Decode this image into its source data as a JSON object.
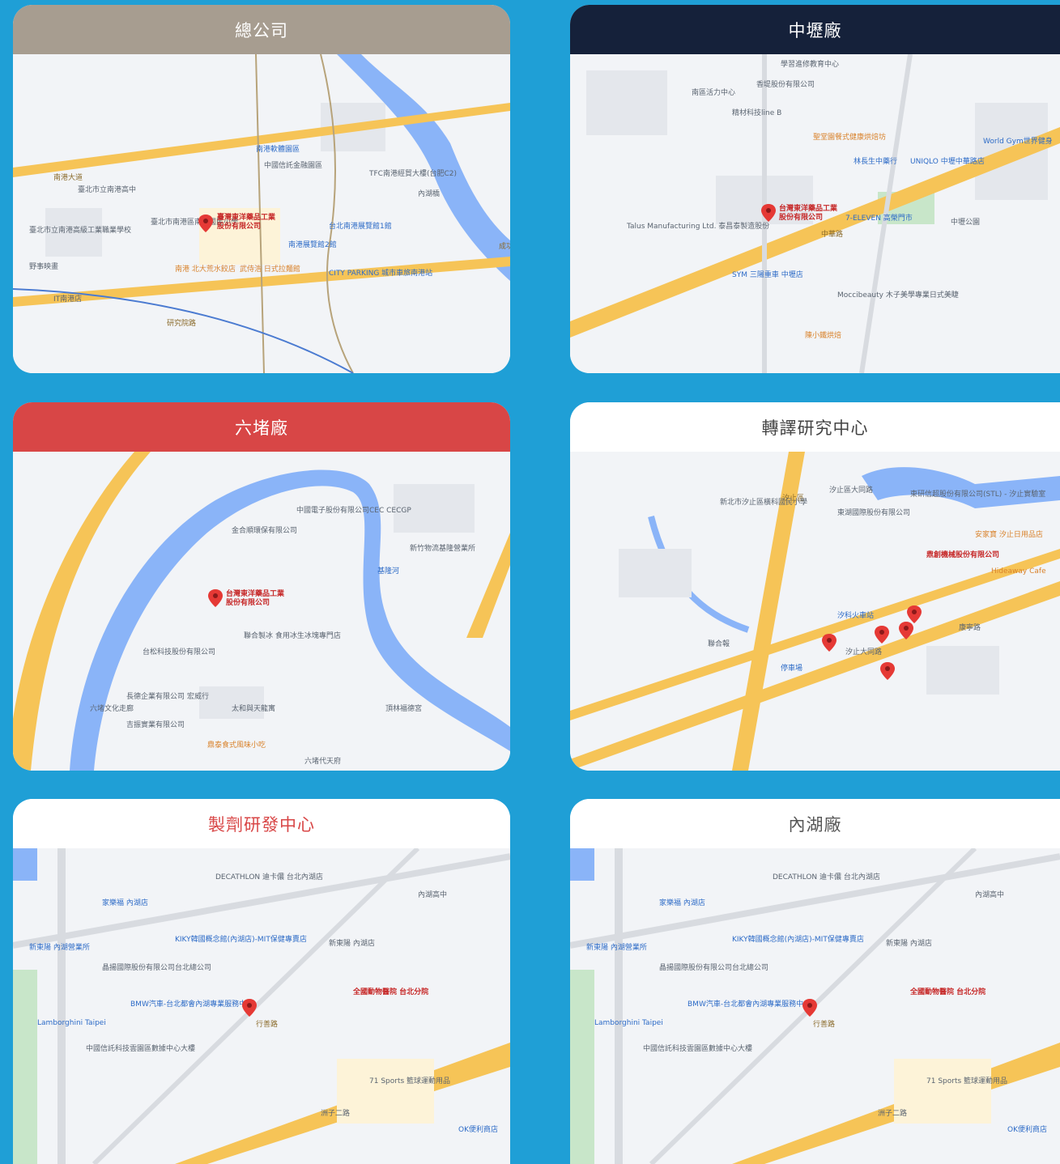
{
  "colors": {
    "page_background": "#1f9fd6",
    "header_hq": "#a79d90",
    "header_zhongli": "#15213a",
    "header_liudu": "#d84646",
    "header_white": "#ffffff",
    "title_red": "#d84646",
    "title_gray": "#555555",
    "map_land": "#f2f4f7",
    "map_river": "#8ab4f8",
    "map_highway": "#f6c457",
    "map_block": "#e4e7ec",
    "map_park": "#c8e6c9",
    "pin_red": "#e53935"
  },
  "locations": [
    {
      "title": "總公司",
      "map": {
        "pin_label_1": "臺灣東洋藥品工業",
        "pin_label_2": "股份有限公司",
        "labels": [
          "臺北市立南港高中",
          "臺北市立南港高級工業職業學校",
          "臺北市南港區南港國民小學",
          "南港軟體園區",
          "中國信託金融園區",
          "TFC南港經貿大樓(台肥C2)",
          "台北南港展覽館1館",
          "南港展覽館2館",
          "CITY PARKING 城市車旅南港站",
          "南港 北大荒水餃店",
          "武侍浩 日式拉麵館",
          "野事映畫",
          "IT南港店",
          "內湖橋",
          "南港大道",
          "研究院路",
          "成功橋"
        ]
      }
    },
    {
      "title": "中壢廠",
      "map": {
        "pin_label_1": "台灣東洋藥品工業",
        "pin_label_2": "股份有限公司",
        "labels": [
          "學習進修教育中心",
          "南區活力中心",
          "香堤股份有限公司",
          "精材科技line B",
          "聖堂園餐式健康烘焙坊",
          "UNIQLO 中壢中華路店",
          "World Gym世界健身",
          "林長生中藥行",
          "7-ELEVEN 高榮門市",
          "Talus Manufacturing Ltd. 泰昌泰製造股份",
          "SYM 三陽重車 中壢店",
          "中壢公園",
          "Moccibeauty 木子美學專業日式美睫",
          "陳小鐵烘焙",
          "中華路"
        ]
      }
    },
    {
      "title": "六堵廠",
      "map": {
        "pin_label_1": "台灣東洋藥品工業",
        "pin_label_2": "股份有限公司",
        "labels": [
          "中國電子股份有限公司CEC CECGP",
          "金合順環保有限公司",
          "新竹物流基隆營業所",
          "聯合製冰 食用冰生冰塊專門店",
          "台松科技股份有限公司",
          "長德企業有限公司",
          "宏威行",
          "太和與天龍寓",
          "吉振實業有限公司",
          "六堵文化走廊",
          "基隆河",
          "鼎泰食式風味小吃",
          "頂林福德宮",
          "六堵代天府"
        ]
      }
    },
    {
      "title": "轉譯研究中心",
      "map": {
        "pin_label_1": "",
        "pin_label_2": "",
        "labels": [
          "汐止區",
          "新北市汐止區橫科國民小學",
          "汐止區大同路",
          "東研信超股份有限公司(STL) - 汐止實驗室",
          "東湖國際股份有限公司",
          "鼎創機械股份有限公司",
          "安家寶 汐止日用品店",
          "汐科火車站",
          "汐止大同路",
          "Hideaway Cafe",
          "康寧路",
          "聯合報",
          "停車場"
        ]
      }
    },
    {
      "title": "製劑研發中心",
      "map": {
        "pin_label_1": "",
        "pin_label_2": "",
        "labels": [
          "DECATHLON 迪卡儂 台北內湖店",
          "家樂福 內湖店",
          "KIKY韓國概念館(內湖店)-MIT保健專賣店",
          "新東陽 內湖營業所",
          "晶揚國際股份有限公司台北總公司",
          "BMW汽車-台北都會內湖專業服務中心",
          "Lamborghini Taipei",
          "中國信託科技雲園區數據中心大樓",
          "新東陽 內湖店",
          "全國動物醫院 台北分院",
          "71 Sports 籃球運動用品",
          "內湖高中",
          "行善路",
          "洲子二路",
          "OK便利商店"
        ]
      }
    },
    {
      "title": "內湖廠",
      "map": {
        "pin_label_1": "",
        "pin_label_2": "",
        "labels": [
          "DECATHLON 迪卡儂 台北內湖店",
          "家樂福 內湖店",
          "KIKY韓國概念館(內湖店)-MIT保健專賣店",
          "新東陽 內湖營業所",
          "晶揚國際股份有限公司台北總公司",
          "BMW汽車-台北都會內湖專業服務中心",
          "Lamborghini Taipei",
          "中國信託科技雲園區數據中心大樓",
          "新東陽 內湖店",
          "全國動物醫院 台北分院",
          "71 Sports 籃球運動用品",
          "內湖高中",
          "行善路",
          "洲子二路",
          "OK便利商店"
        ]
      }
    }
  ]
}
